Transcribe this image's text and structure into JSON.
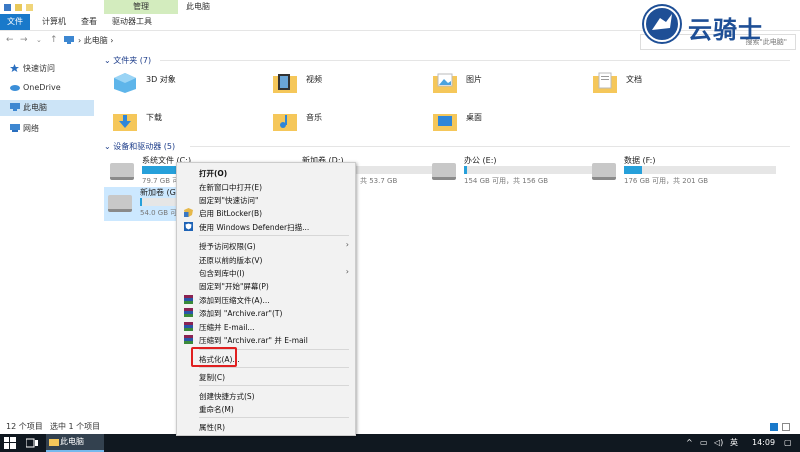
{
  "window": {
    "title": "此电脑",
    "context_tab": "管理"
  },
  "ribbon": {
    "tabs": [
      "文件",
      "计算机",
      "查看",
      "驱动器工具"
    ]
  },
  "address": {
    "path": "此电脑",
    "search_placeholder": "搜索\"此电脑\""
  },
  "logo": {
    "text": "云骑士"
  },
  "nav": {
    "items": [
      {
        "label": "快速访问",
        "icon": "star-icon"
      },
      {
        "label": "OneDrive",
        "icon": "cloud-icon"
      },
      {
        "label": "此电脑",
        "icon": "computer-icon"
      },
      {
        "label": "网络",
        "icon": "network-icon"
      }
    ]
  },
  "folders": {
    "title": "文件夹 (7)",
    "items": [
      "3D 对象",
      "视频",
      "图片",
      "文档",
      "下载",
      "音乐",
      "桌面"
    ]
  },
  "drives": {
    "title": "设备和驱动器 (5)",
    "items": [
      {
        "name": "系统文件 (C:)",
        "info": "79.7 GB 可...",
        "used": 0.45
      },
      {
        "name": "新加卷 (D:)",
        "info": "共 53.7 GB",
        "used": 0.3
      },
      {
        "name": "办公 (E:)",
        "info": "154 GB 可用，共 156 GB",
        "used": 0.02
      },
      {
        "name": "数据 (F:)",
        "info": "176 GB 可用，共 201 GB",
        "used": 0.12
      },
      {
        "name": "新加卷 (G:)",
        "info": "54.0 GB 可",
        "used": 0.05
      }
    ]
  },
  "context_menu": {
    "items": [
      {
        "label": "打开(O)",
        "bold": true
      },
      {
        "label": "在新窗口中打开(E)"
      },
      {
        "label": "固定到\"快速访问\""
      },
      {
        "label": "启用 BitLocker(B)"
      },
      {
        "label": "使用 Windows Defender扫描..."
      },
      {
        "label": "授予访问权限(G)"
      },
      {
        "label": "还原以前的版本(V)"
      },
      {
        "label": "包含到库中(I)"
      },
      {
        "label": "固定到\"开始\"屏幕(P)"
      },
      {
        "label": "添加到压缩文件(A)..."
      },
      {
        "label": "添加到 \"Archive.rar\"(T)"
      },
      {
        "label": "压缩并 E-mail..."
      },
      {
        "label": "压缩到 \"Archive.rar\" 并 E-mail"
      },
      {
        "label": "格式化(A)..."
      },
      {
        "label": "复制(C)"
      },
      {
        "label": "创建快捷方式(S)"
      },
      {
        "label": "重命名(M)"
      },
      {
        "label": "属性(R)"
      }
    ]
  },
  "status": {
    "count": "12 个项目",
    "selected": "选中 1 个项目"
  },
  "taskbar": {
    "app": "此电脑",
    "ime": "英",
    "clock": "14:09"
  },
  "colors": {
    "accent": "#1979ca",
    "drive_fill": "#26a0da",
    "highlight": "#e02020",
    "context_tab": "#d3ecbe",
    "logo": "#1e4f96"
  }
}
